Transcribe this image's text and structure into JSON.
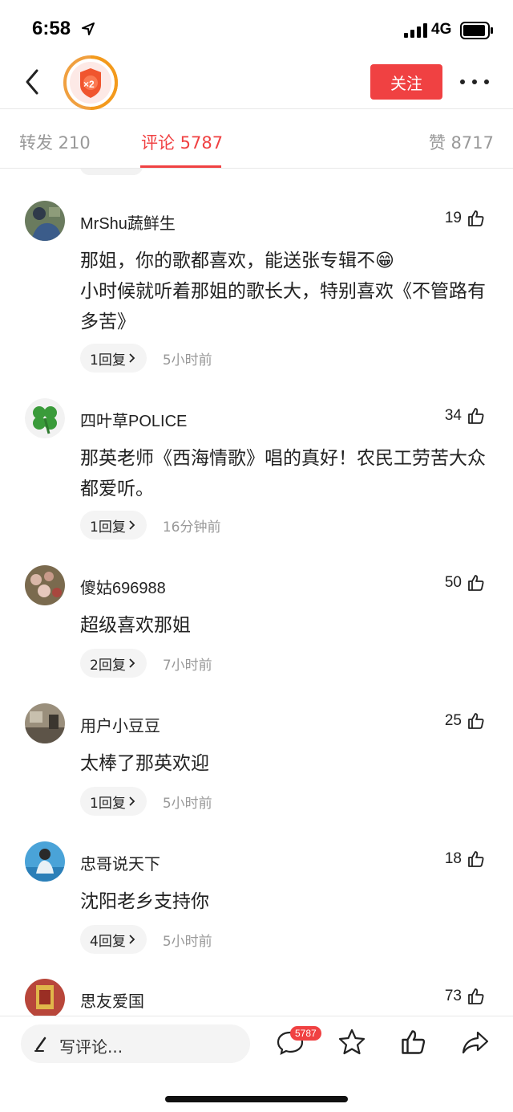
{
  "status_bar": {
    "time": "6:58",
    "network": "4G"
  },
  "header": {
    "follow_label": "关注",
    "avatar_badge": "×2"
  },
  "tabs": [
    {
      "label": "转发 210"
    },
    {
      "label": "评论 5787"
    },
    {
      "label": "赞 8717"
    }
  ],
  "comments": [
    {
      "name": "MrShu蔬鲜生",
      "likes": "19",
      "text": "那姐，你的歌都喜欢，能送张专辑不😁\n小时候就听着那姐的歌长大，特别喜欢《不管路有多苦》",
      "replies": "1回复",
      "time": "5小时前"
    },
    {
      "name": "四叶草POLICE",
      "likes": "34",
      "text": "那英老师《西海情歌》唱的真好！农民工劳苦大众都爱听。",
      "replies": "1回复",
      "time": "16分钟前"
    },
    {
      "name": "傻姑696988",
      "likes": "50",
      "text": "超级喜欢那姐",
      "replies": "2回复",
      "time": "7小时前"
    },
    {
      "name": "用户小豆豆",
      "likes": "25",
      "text": "太棒了那英欢迎",
      "replies": "1回复",
      "time": "5小时前"
    },
    {
      "name": "忠哥说天下",
      "likes": "18",
      "text": "沈阳老乡支持你",
      "replies": "4回复",
      "time": "5小时前"
    },
    {
      "name": "思友爱国",
      "likes": "73",
      "text": "",
      "replies": "",
      "time": ""
    }
  ],
  "bottom_bar": {
    "write_placeholder": "写评论...",
    "comment_count": "5787"
  },
  "colors": {
    "accent": "#f04142",
    "muted_text": "#999999",
    "pill_bg": "#f4f4f4"
  }
}
